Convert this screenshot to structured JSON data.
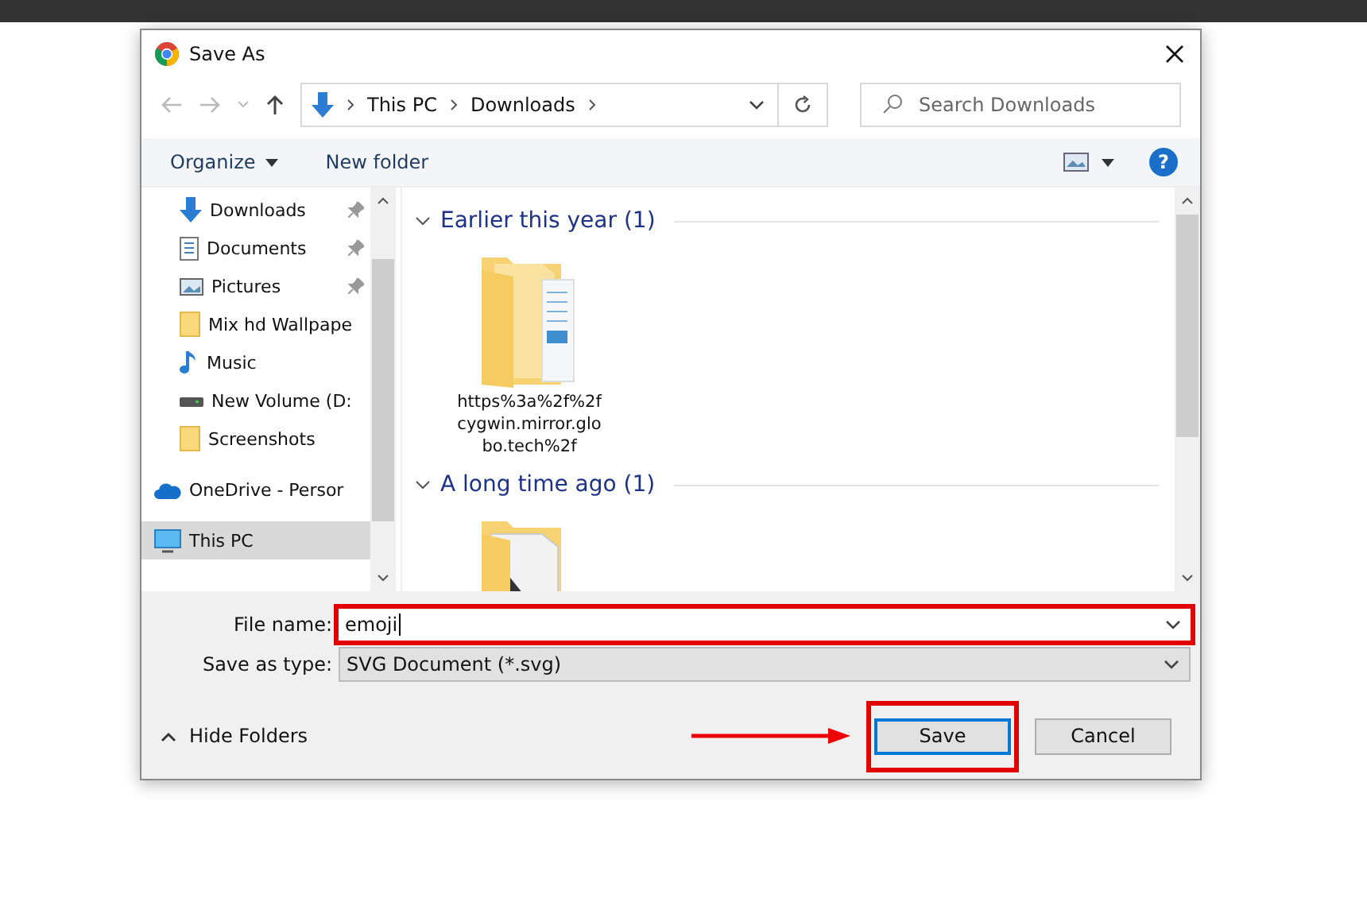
{
  "window": {
    "title": "Save As"
  },
  "address": {
    "crumbs": [
      "This PC",
      "Downloads"
    ]
  },
  "search": {
    "placeholder": "Search Downloads"
  },
  "toolbar": {
    "organize": "Organize",
    "new_folder": "New folder",
    "help": "?"
  },
  "sidebar": {
    "items": [
      {
        "label": "Downloads",
        "kind": "download",
        "pinned": true,
        "selected": false
      },
      {
        "label": "Documents",
        "kind": "document",
        "pinned": true,
        "selected": false
      },
      {
        "label": "Pictures",
        "kind": "picture",
        "pinned": true,
        "selected": false
      },
      {
        "label": "Mix hd Wallpape",
        "kind": "folder",
        "pinned": false,
        "selected": false
      },
      {
        "label": "Music",
        "kind": "music",
        "pinned": false,
        "selected": false
      },
      {
        "label": "New Volume (D:",
        "kind": "drive",
        "pinned": false,
        "selected": false
      },
      {
        "label": "Screenshots",
        "kind": "folder",
        "pinned": false,
        "selected": false
      },
      {
        "label": "OneDrive - Persor",
        "kind": "cloud",
        "pinned": false,
        "selected": false
      },
      {
        "label": "This PC",
        "kind": "pc",
        "pinned": false,
        "selected": true
      }
    ]
  },
  "groups": [
    {
      "title": "Earlier this year (1)",
      "expanded": true,
      "files": [
        {
          "kind": "document-folder",
          "name": "https%3a%2f%2fcygwin.mirror.globo.tech%2f"
        }
      ]
    },
    {
      "title": "A long time ago (1)",
      "expanded": true,
      "files": [
        {
          "kind": "folder"
        }
      ]
    }
  ],
  "form": {
    "file_name_label": "File name:",
    "file_name": "emoji",
    "type_label": "Save as type:",
    "type": "SVG Document (*.svg)"
  },
  "hide_folders": "Hide Folders",
  "buttons": [
    {
      "label": "Save",
      "kind": "primary"
    },
    {
      "label": "Cancel",
      "kind": "normal"
    }
  ]
}
